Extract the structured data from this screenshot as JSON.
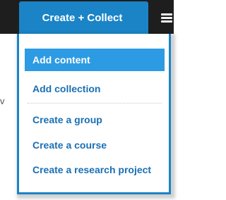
{
  "topbar": {
    "create_collect_label": "Create + Collect"
  },
  "background": {
    "left_fragment": "v"
  },
  "menu": {
    "items": [
      {
        "label": "Add content",
        "active": true
      },
      {
        "label": "Add collection",
        "active": false
      },
      {
        "label": "Create a group",
        "active": false
      },
      {
        "label": "Create a course",
        "active": false
      },
      {
        "label": "Create a research project",
        "active": false
      }
    ]
  },
  "colors": {
    "accent": "#1a84c7",
    "highlight": "#2d9be3",
    "link": "#1a6fb3",
    "topbar": "#1e1e1e"
  },
  "icons": {
    "topbar_right": "stack-icon"
  }
}
